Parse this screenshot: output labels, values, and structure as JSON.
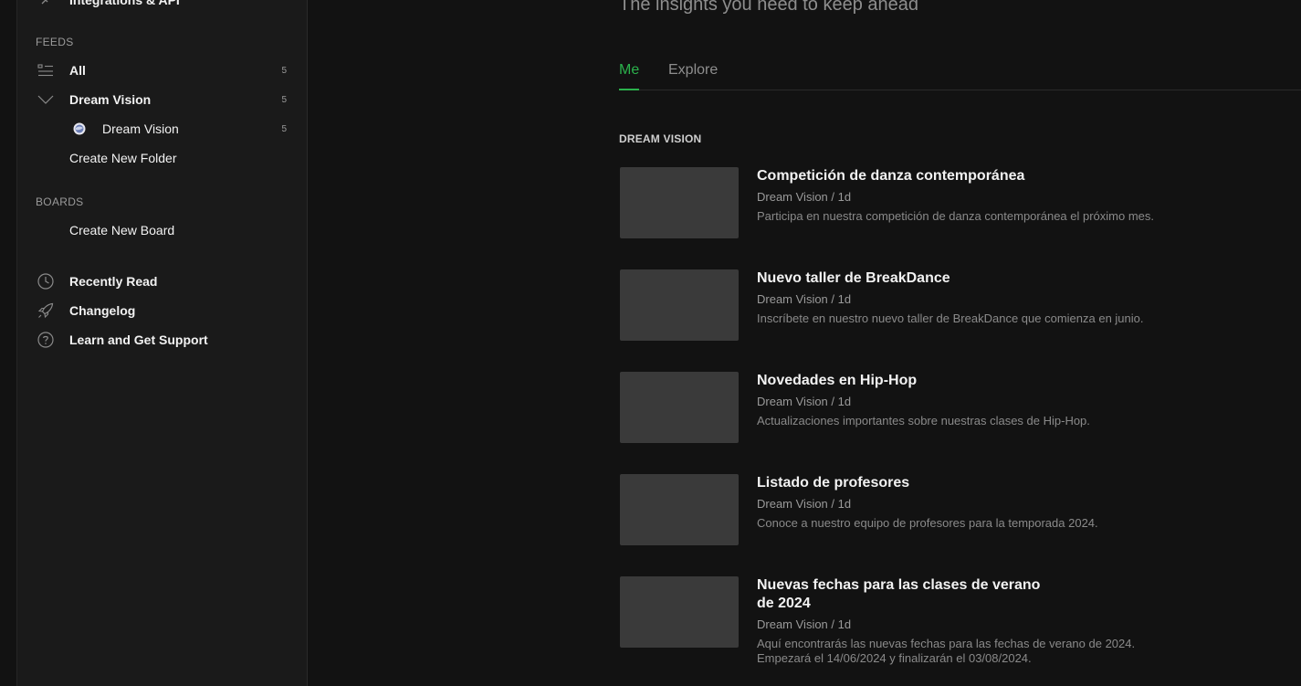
{
  "sidebar": {
    "top_item": "Integrations & API",
    "feeds_section": "FEEDS",
    "feeds": [
      {
        "label": "All",
        "count": "5"
      },
      {
        "label": "Dream Vision",
        "count": "5"
      },
      {
        "label": "Dream Vision",
        "count": "5"
      }
    ],
    "create_folder": "Create New Folder",
    "boards_section": "BOARDS",
    "create_board": "Create New Board",
    "links": [
      {
        "label": "Recently Read",
        "icon": "clock-icon"
      },
      {
        "label": "Changelog",
        "icon": "rocket-icon"
      },
      {
        "label": "Learn and Get Support",
        "icon": "help-icon"
      }
    ]
  },
  "main": {
    "tagline": "The insights you need to keep ahead",
    "tabs": [
      {
        "label": "Me",
        "active": true
      },
      {
        "label": "Explore",
        "active": false
      }
    ],
    "section_title": "DREAM VISION",
    "articles": [
      {
        "title": "Competición de danza contemporánea",
        "meta": "Dream Vision / 1d",
        "desc": "Participa en nuestra competición de danza contemporánea el próximo mes."
      },
      {
        "title": "Nuevo taller de BreakDance",
        "meta": "Dream Vision / 1d",
        "desc": "Inscríbete en nuestro nuevo taller de BreakDance que comienza en junio."
      },
      {
        "title": "Novedades en Hip-Hop",
        "meta": "Dream Vision / 1d",
        "desc": "Actualizaciones importantes sobre nuestras clases de Hip-Hop."
      },
      {
        "title": "Listado de profesores",
        "meta": "Dream Vision / 1d",
        "desc": "Conoce a nuestro equipo de profesores para la temporada 2024."
      },
      {
        "title": "Nuevas fechas para las clases de verano de 2024",
        "meta": "Dream Vision / 1d",
        "desc": "Aquí encontrarás las nuevas fechas para las fechas de verano de 2024. Empezará el 14/06/2024 y finalizarán el 03/08/2024."
      }
    ]
  },
  "colors": {
    "accent": "#2bb24c",
    "background": "#121212",
    "sidebar": "#1a1a1a",
    "thumbnail": "#3a3a3a"
  }
}
